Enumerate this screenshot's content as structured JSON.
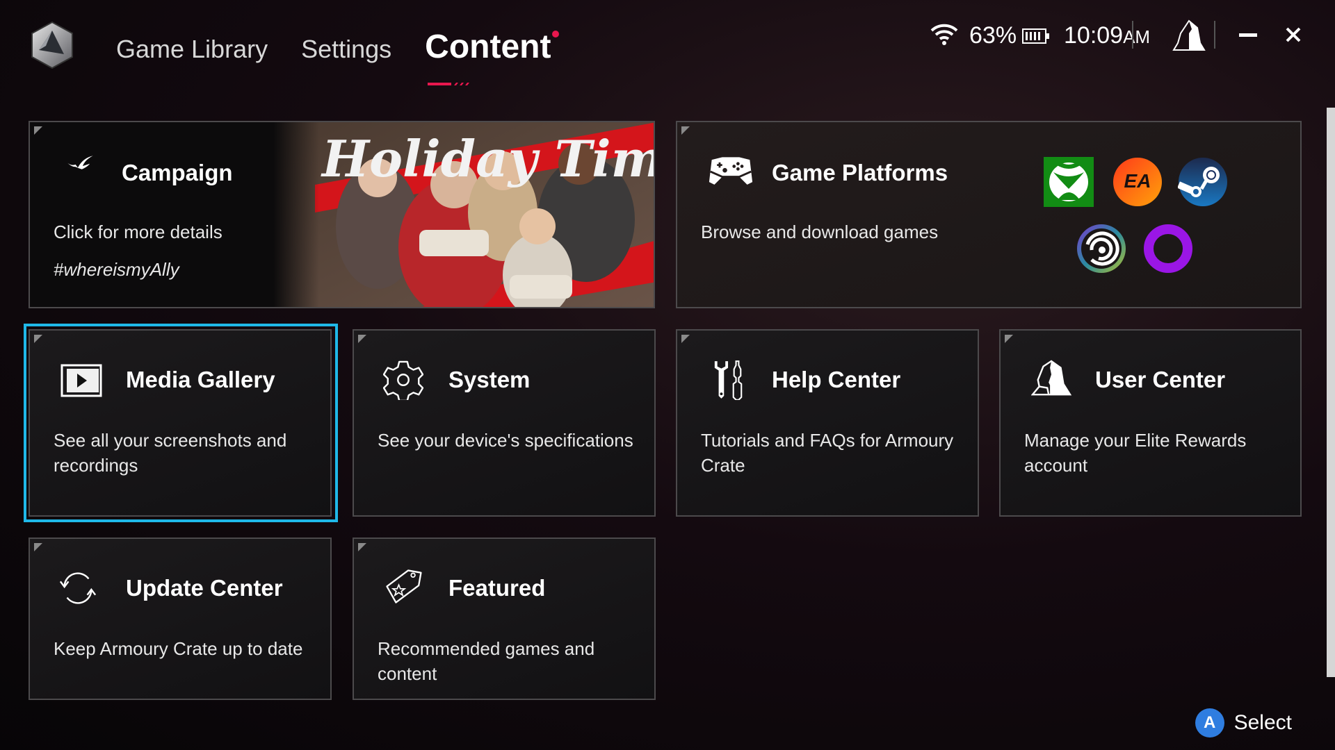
{
  "header": {
    "nav": [
      {
        "label": "Game Library",
        "active": false
      },
      {
        "label": "Settings",
        "active": false
      },
      {
        "label": "Content",
        "active": true
      }
    ],
    "accent_color": "#e8174e"
  },
  "status": {
    "wifi_icon": "wifi-icon",
    "battery_percent": "63%",
    "battery_icon": "battery-icon",
    "time": "10:09",
    "ampm": "AM",
    "user_icon": "user-icon",
    "minimize_icon": "minimize-icon",
    "close_icon": "close-icon"
  },
  "cards": {
    "campaign": {
      "title": "Campaign",
      "desc": "Click for more details",
      "hashtag": "#whereismyAlly",
      "banner_text": "Holiday Time"
    },
    "platforms": {
      "title": "Game Platforms",
      "desc": "Browse and download games",
      "logos": [
        "Xbox",
        "EA",
        "Steam",
        "Ubisoft",
        "GOG Galaxy"
      ]
    },
    "media": {
      "title": "Media Gallery",
      "desc": "See all your screenshots and recordings"
    },
    "system": {
      "title": "System",
      "desc": "See your device's specifications"
    },
    "help": {
      "title": "Help Center",
      "desc": "Tutorials and FAQs for Armoury Crate"
    },
    "user": {
      "title": "User Center",
      "desc": "Manage your Elite Rewards account"
    },
    "update": {
      "title": "Update Center",
      "desc": "Keep Armoury Crate up to date"
    },
    "featured": {
      "title": "Featured",
      "desc": "Recommended games and content"
    }
  },
  "focus_color": "#1fb8e8",
  "footer": {
    "button_glyph": "A",
    "label": "Select",
    "button_color": "#2f7de0"
  }
}
